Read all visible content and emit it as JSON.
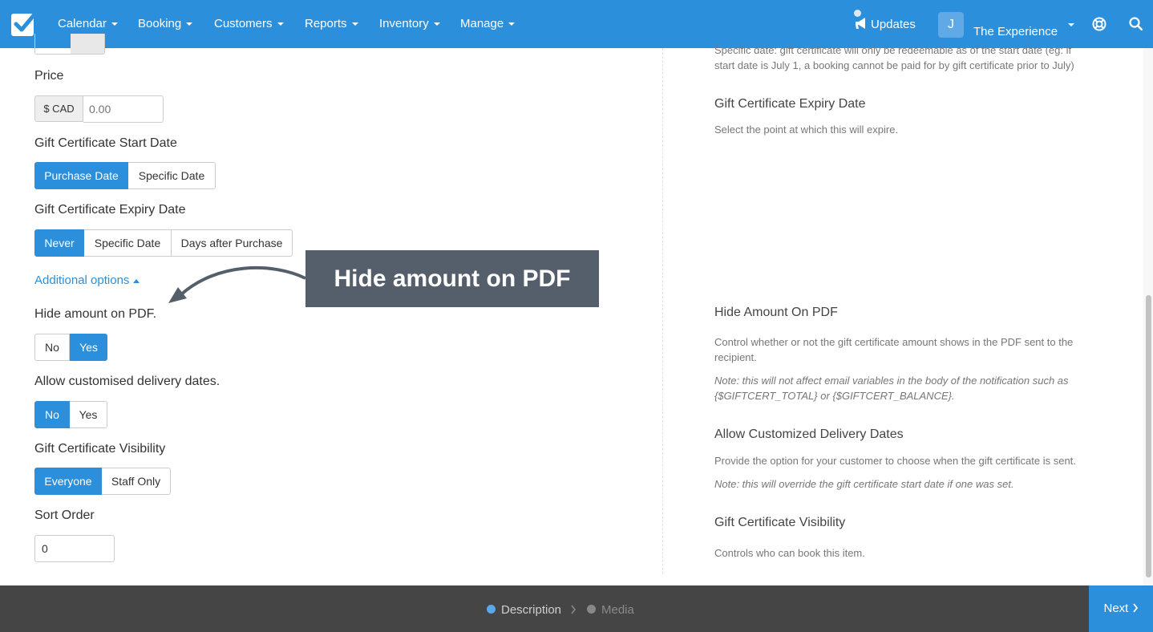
{
  "nav": {
    "items": [
      {
        "label": "Calendar"
      },
      {
        "label": "Booking"
      },
      {
        "label": "Customers"
      },
      {
        "label": "Reports"
      },
      {
        "label": "Inventory"
      },
      {
        "label": "Manage"
      }
    ],
    "updates_label": "Updates",
    "avatar_initial": "J",
    "account_name": "The Experience",
    "brand_color": "#2b8fdc"
  },
  "form": {
    "price": {
      "label": "Price",
      "currency": "$ CAD",
      "placeholder": "0.00"
    },
    "start_date": {
      "label": "Gift Certificate Start Date",
      "options": [
        "Purchase Date",
        "Specific Date"
      ],
      "selected": "Purchase Date"
    },
    "expiry_date": {
      "label": "Gift Certificate Expiry Date",
      "options": [
        "Never",
        "Specific Date",
        "Days after Purchase"
      ],
      "selected": "Never"
    },
    "additional_options": "Additional options",
    "hide_amount": {
      "label": "Hide amount on PDF.",
      "options": [
        "No",
        "Yes"
      ],
      "selected": "Yes"
    },
    "custom_delivery": {
      "label": "Allow customised delivery dates.",
      "options": [
        "No",
        "Yes"
      ],
      "selected": "No"
    },
    "visibility": {
      "label": "Gift Certificate Visibility",
      "options": [
        "Everyone",
        "Staff Only"
      ],
      "selected": "Everyone"
    },
    "sort_order": {
      "label": "Sort Order",
      "value": "0"
    }
  },
  "callout": "Hide amount on PDF",
  "help": {
    "start_date_text": "Specific date: gift certificate will only be redeemable as of the start date (eg: if start date is July 1, a booking cannot be paid for by gift certificate prior to July)",
    "expiry_title": "Gift Certificate Expiry Date",
    "expiry_text": "Select the point at which this will expire.",
    "hide_amount_title": "Hide Amount On PDF",
    "hide_amount_text": "Control whether or not the gift certificate amount shows in the PDF sent to the recipient.",
    "hide_amount_note": "Note: this will not affect email variables in the body of the notification such as {$GIFTCERT_TOTAL} or {$GIFTCERT_BALANCE}.",
    "delivery_title": "Allow Customized Delivery Dates",
    "delivery_text": "Provide the option for your customer to choose when the gift certificate is sent.",
    "delivery_note": "Note: this will override the gift certificate start date if one was set.",
    "visibility_title": "Gift Certificate Visibility",
    "visibility_text": "Controls who can book this item."
  },
  "footer": {
    "steps": [
      {
        "label": "Description",
        "status": "current"
      },
      {
        "label": "Media",
        "status": "upcoming"
      }
    ],
    "next_label": "Next"
  }
}
